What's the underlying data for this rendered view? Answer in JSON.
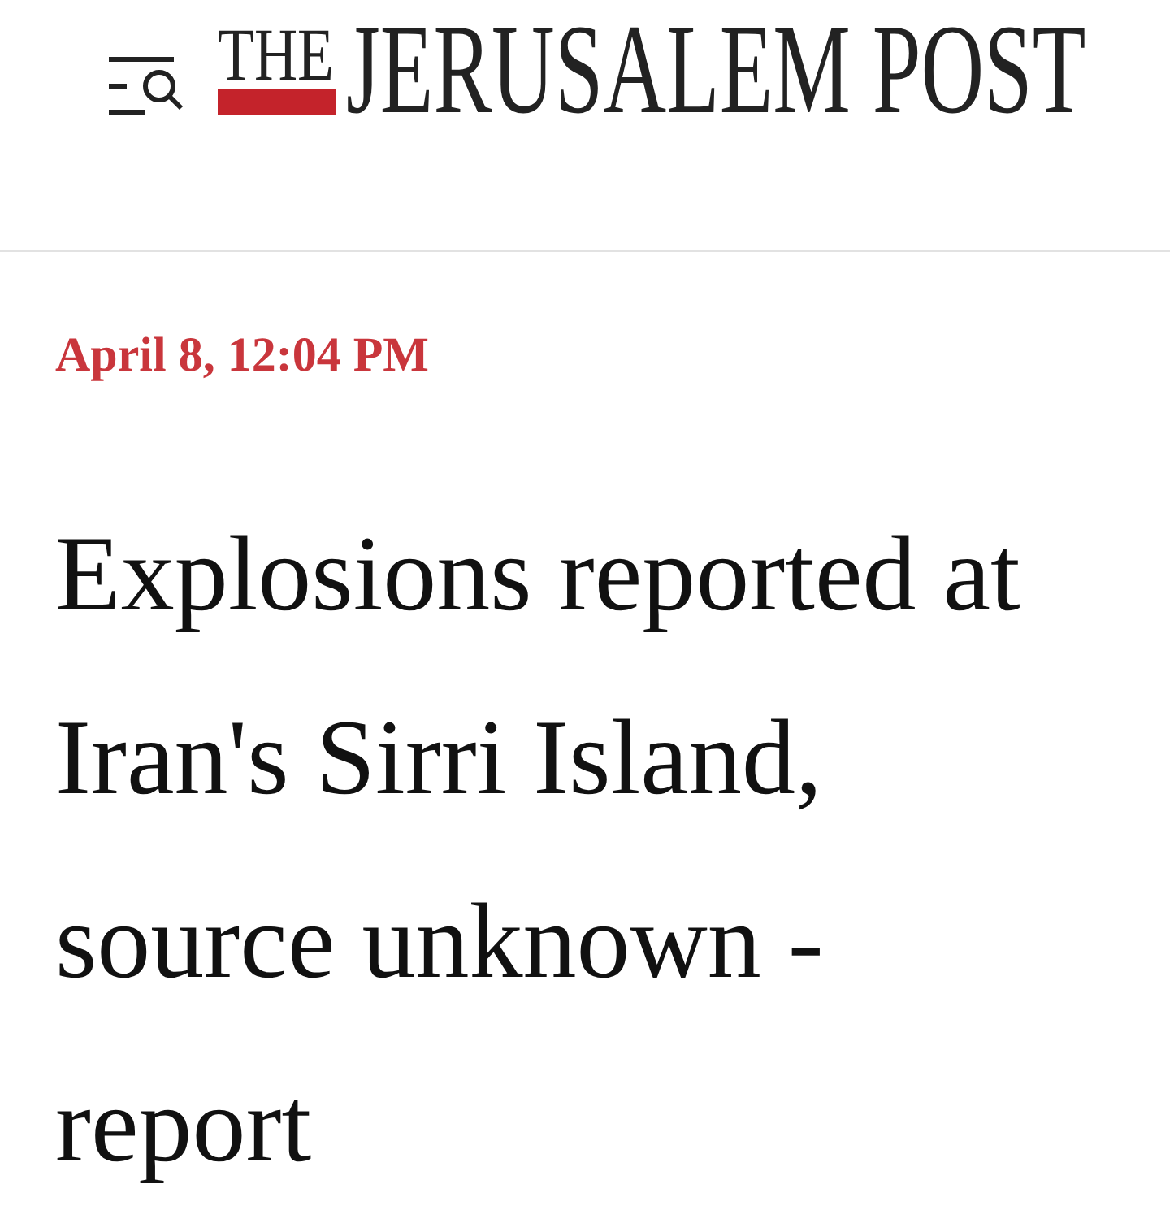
{
  "header": {
    "logo": {
      "prefix": "THE",
      "name": "JERUSALEM POST"
    }
  },
  "article": {
    "timestamp": "April 8, 12:04 PM",
    "headline": "Explosions reported at Iran's Sirri Island, source unknown - report"
  }
}
